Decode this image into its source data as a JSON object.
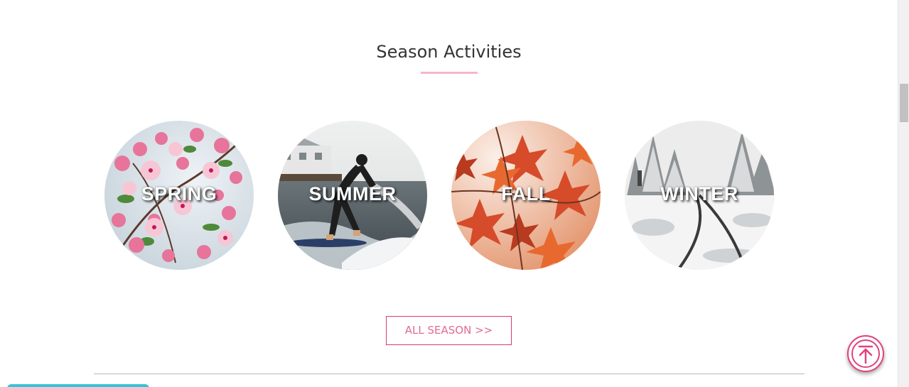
{
  "section": {
    "title": "Season Activities"
  },
  "seasons": [
    {
      "label": "SPRING",
      "icon": "cherry-blossom-photo"
    },
    {
      "label": "SUMMER",
      "icon": "surfer-photo"
    },
    {
      "label": "FALL",
      "icon": "maple-leaves-photo"
    },
    {
      "label": "WINTER",
      "icon": "snowy-railway-photo"
    }
  ],
  "all_season_button": {
    "label": "ALL SEASON >>"
  },
  "scroll_top": {
    "icon": "arrow-up-to-top-icon"
  },
  "colors": {
    "accent_pink": "#e0437c",
    "underline_pink": "#f4b6cb",
    "button_text": "#e06b95",
    "bottom_tab": "#37c3d8"
  }
}
